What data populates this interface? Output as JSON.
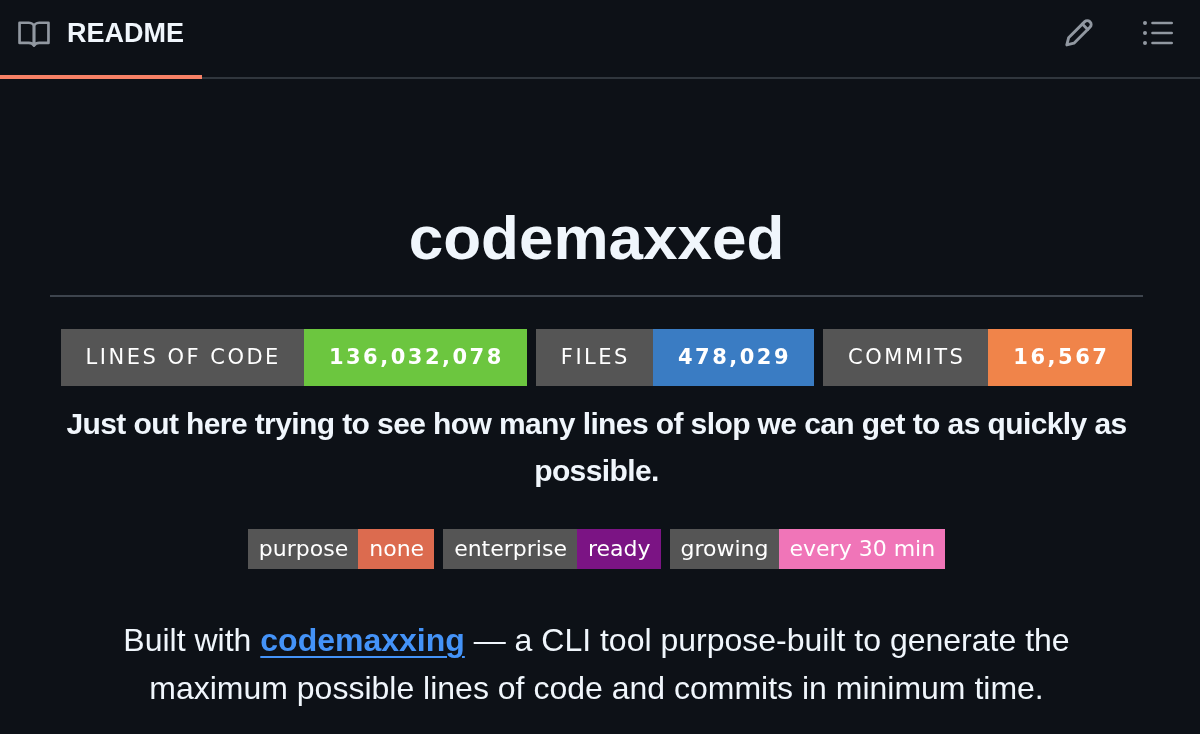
{
  "tab": {
    "label": "README",
    "selected": true
  },
  "readme": {
    "title": "codemaxxed",
    "stat_badges": [
      {
        "label": "LINES OF CODE",
        "value": "136,032,078",
        "color": "#6cc63f"
      },
      {
        "label": "FILES",
        "value": "478,029",
        "color": "#3a7cc3"
      },
      {
        "label": "COMMITS",
        "value": "16,567",
        "color": "#f0844a"
      }
    ],
    "tagline": "Just out here trying to see how many lines of slop we can get to as quickly as possible.",
    "badges": [
      {
        "label": "purpose",
        "value": "none",
        "color": "#dc6b4f"
      },
      {
        "label": "enterprise",
        "value": "ready",
        "color": "#7b1484"
      },
      {
        "label": "growing",
        "value": "every 30 min",
        "color": "#f075b8"
      }
    ],
    "description": {
      "before": "Built with",
      "link": "codemaxxing",
      "after": "— a CLI tool purpose-built to generate the maximum possible lines of code and commits in minimum time."
    }
  }
}
